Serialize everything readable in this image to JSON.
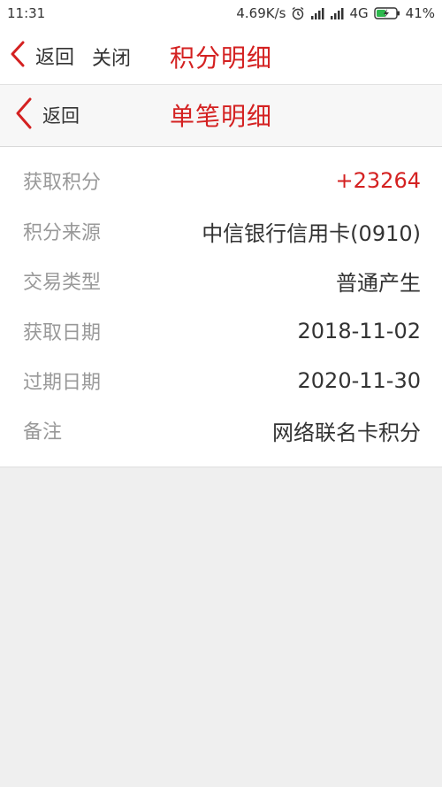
{
  "status_bar": {
    "time": "11:31",
    "network_speed": "4.69K/s",
    "network_type": "4G",
    "battery": "41%",
    "icons": [
      "alarm-icon",
      "signal-icon",
      "signal-icon",
      "battery-charging-icon"
    ]
  },
  "top_nav": {
    "back_label": "返回",
    "close_label": "关闭",
    "title": "积分明细"
  },
  "sub_nav": {
    "back_label": "返回",
    "title": "单笔明细"
  },
  "details": [
    {
      "label": "获取积分",
      "value": "+23264"
    },
    {
      "label": "积分来源",
      "value": "中信银行信用卡(0910)"
    },
    {
      "label": "交易类型",
      "value": "普通产生"
    },
    {
      "label": "获取日期",
      "value": "2018-11-02"
    },
    {
      "label": "过期日期",
      "value": "2020-11-30"
    },
    {
      "label": "备注",
      "value": "网络联名卡积分"
    }
  ],
  "colors": {
    "accent": "#d42121",
    "label_gray": "#999999",
    "text": "#333333",
    "background": "#efefef"
  }
}
